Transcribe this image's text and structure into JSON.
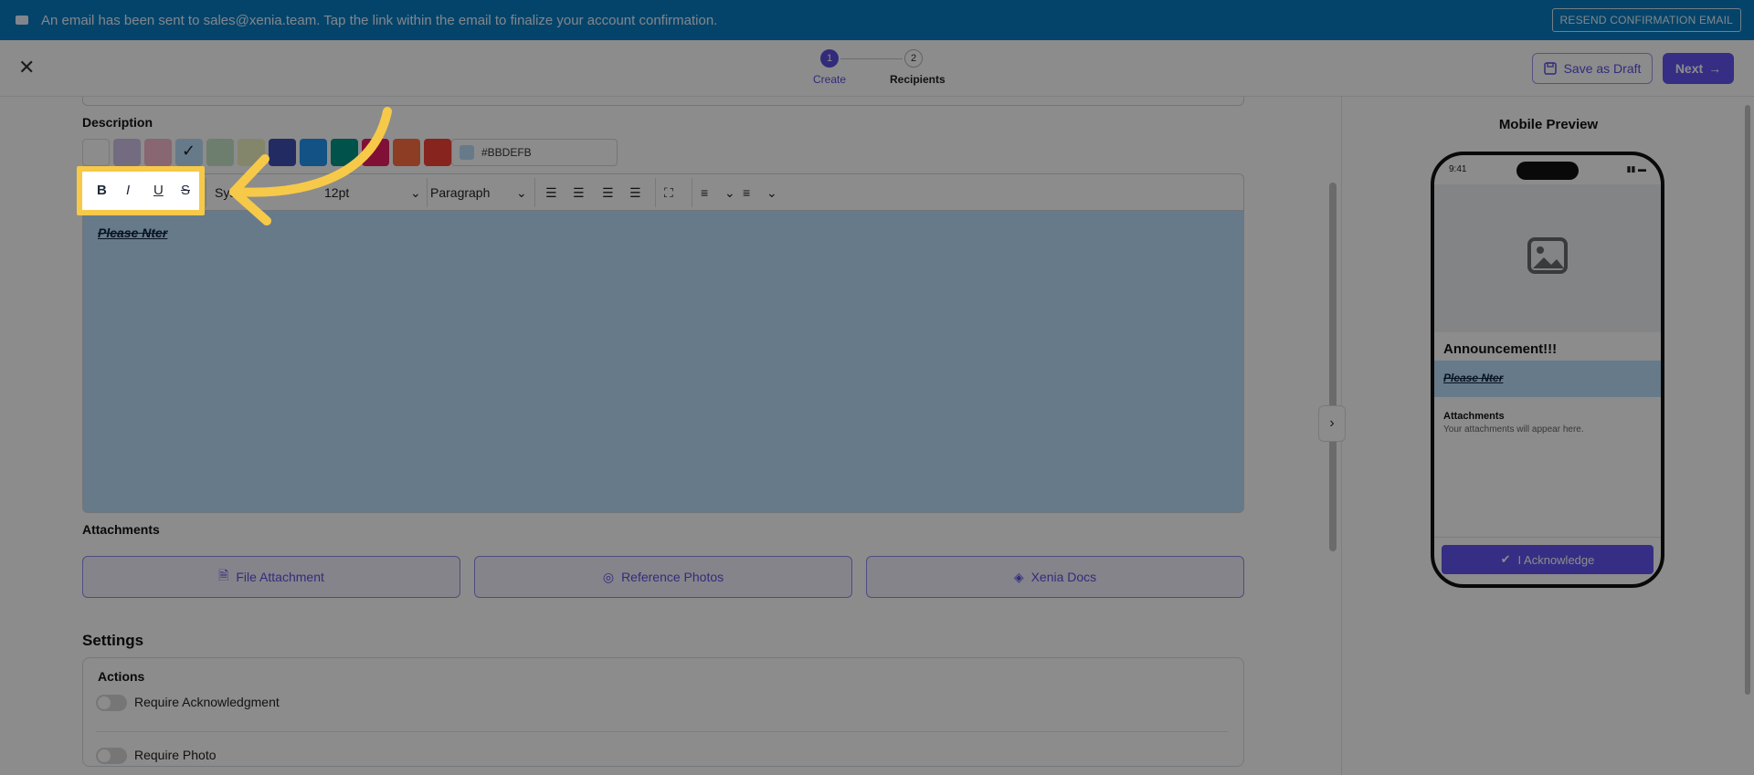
{
  "banner": {
    "message": "An email has been sent to sales@xenia.team. Tap the link within the email to finalize your account confirmation.",
    "resend_label": "RESEND CONFIRMATION EMAIL",
    "icon": "mail-icon"
  },
  "header": {
    "close_icon": "close-icon",
    "steps": [
      {
        "number": "1",
        "label": "Create",
        "state": "active"
      },
      {
        "number": "2",
        "label": "Recipients",
        "state": "pending"
      }
    ],
    "save_draft_label": "Save as Draft",
    "next_label": "Next",
    "accent_color": "#5b4fe0"
  },
  "editor": {
    "description_label": "Description",
    "swatches": [
      "#ffffff",
      "#d1c4e9",
      "#f8bbd0",
      "#bbdefb",
      "#c8e6c9",
      "#f0f4c3",
      "#3f51b5",
      "#2196f3",
      "#009688",
      "#e91e63",
      "#ff7043",
      "#f44336"
    ],
    "selected_swatch": "#bbdefb",
    "hex_value": "#BBDEFB",
    "toolbar": {
      "bold": "B",
      "italic": "I",
      "underline": "U",
      "strike": "S",
      "font": "Sys",
      "size": "12pt",
      "block": "Paragraph"
    },
    "content": "Please Nter",
    "background": "#bbdefb"
  },
  "attachments": {
    "label": "Attachments",
    "buttons": [
      {
        "label": "File Attachment",
        "icon": "file-attachment-icon"
      },
      {
        "label": "Reference Photos",
        "icon": "photo-icon"
      },
      {
        "label": "Xenia Docs",
        "icon": "layers-icon"
      }
    ]
  },
  "settings": {
    "label": "Settings",
    "actions_label": "Actions",
    "toggles": [
      {
        "label": "Require Acknowledgment",
        "on": false
      },
      {
        "label": "Require Photo",
        "on": false
      }
    ]
  },
  "preview": {
    "title": "Mobile Preview",
    "time": "9:41",
    "announcement_title": "Announcement!!!",
    "description": "Please Nter",
    "attachments_label": "Attachments",
    "attachments_placeholder": "Your attachments will appear here.",
    "acknowledge_label": "I Acknowledge"
  }
}
